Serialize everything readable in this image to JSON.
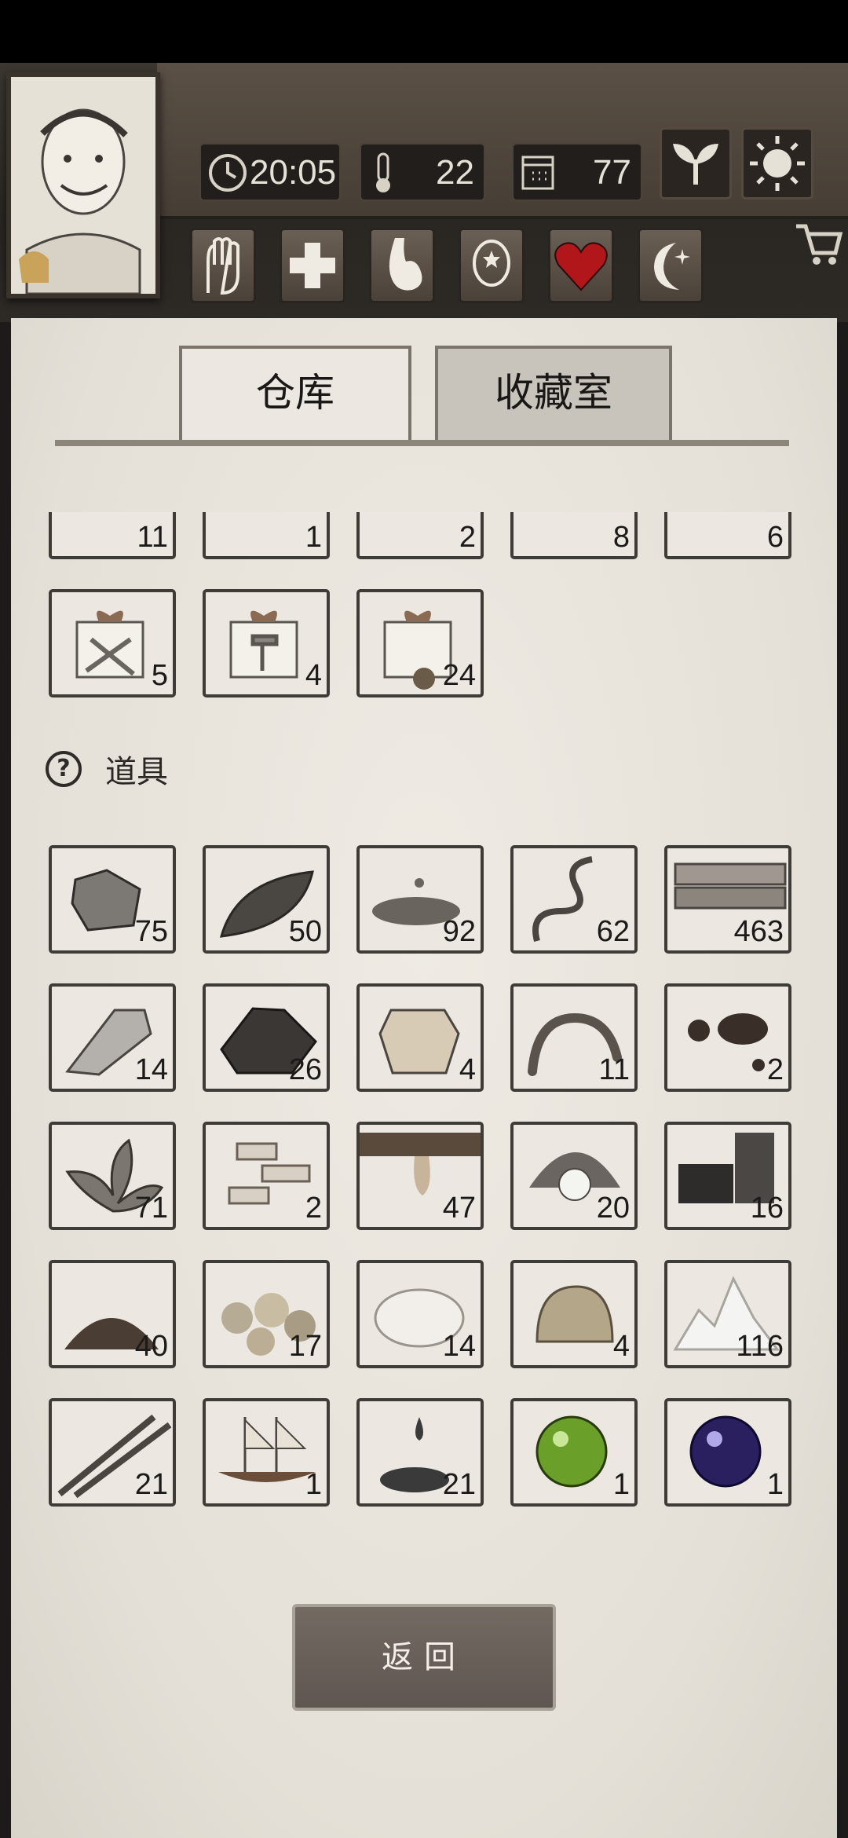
{
  "hud": {
    "time": "20:05",
    "temperature": "22",
    "day": "77",
    "top_buttons": [
      "sprout-icon",
      "sun-icon",
      "cart-icon"
    ],
    "action_buttons": [
      "hand-icon",
      "medical-cross-icon",
      "stomach-icon",
      "head-icon",
      "heart-icon",
      "moon-star-icon"
    ]
  },
  "tabs": [
    {
      "label": "仓库",
      "active": true
    },
    {
      "label": "收藏室",
      "active": false
    }
  ],
  "partial_row": [
    "11",
    "1",
    "2",
    "8",
    "6"
  ],
  "crates": [
    {
      "name": "crate-weapons",
      "qty": "5"
    },
    {
      "name": "crate-tools",
      "qty": "4"
    },
    {
      "name": "crate-wood",
      "qty": "24"
    }
  ],
  "section_title": "道具",
  "items": [
    [
      {
        "name": "stone-item",
        "qty": "75"
      },
      {
        "name": "leaf-item",
        "qty": "50"
      },
      {
        "name": "mud-item",
        "qty": "92"
      },
      {
        "name": "vine-item",
        "qty": "62"
      },
      {
        "name": "planks-item",
        "qty": "463"
      }
    ],
    [
      {
        "name": "flint-item",
        "qty": "14"
      },
      {
        "name": "ore-item",
        "qty": "26"
      },
      {
        "name": "hide-item",
        "qty": "4"
      },
      {
        "name": "worm-item",
        "qty": "11"
      },
      {
        "name": "oil-item",
        "qty": "2"
      }
    ],
    [
      {
        "name": "herb-item",
        "qty": "71"
      },
      {
        "name": "bark-item",
        "qty": "2"
      },
      {
        "name": "resin-item",
        "qty": "47"
      },
      {
        "name": "pearl-item",
        "qty": "20"
      },
      {
        "name": "coal-item",
        "qty": "16"
      }
    ],
    [
      {
        "name": "soil-item",
        "qty": "40"
      },
      {
        "name": "gold-ore-item",
        "qty": "17"
      },
      {
        "name": "cotton-item",
        "qty": "14"
      },
      {
        "name": "clay-item",
        "qty": "4"
      },
      {
        "name": "salt-item",
        "qty": "116"
      }
    ],
    [
      {
        "name": "bamboo-item",
        "qty": "21"
      },
      {
        "name": "ship-item",
        "qty": "1"
      },
      {
        "name": "ink-item",
        "qty": "21"
      },
      {
        "name": "green-orb-item",
        "qty": "1"
      },
      {
        "name": "purple-orb-item",
        "qty": "1"
      }
    ]
  ],
  "back_button": "返回"
}
